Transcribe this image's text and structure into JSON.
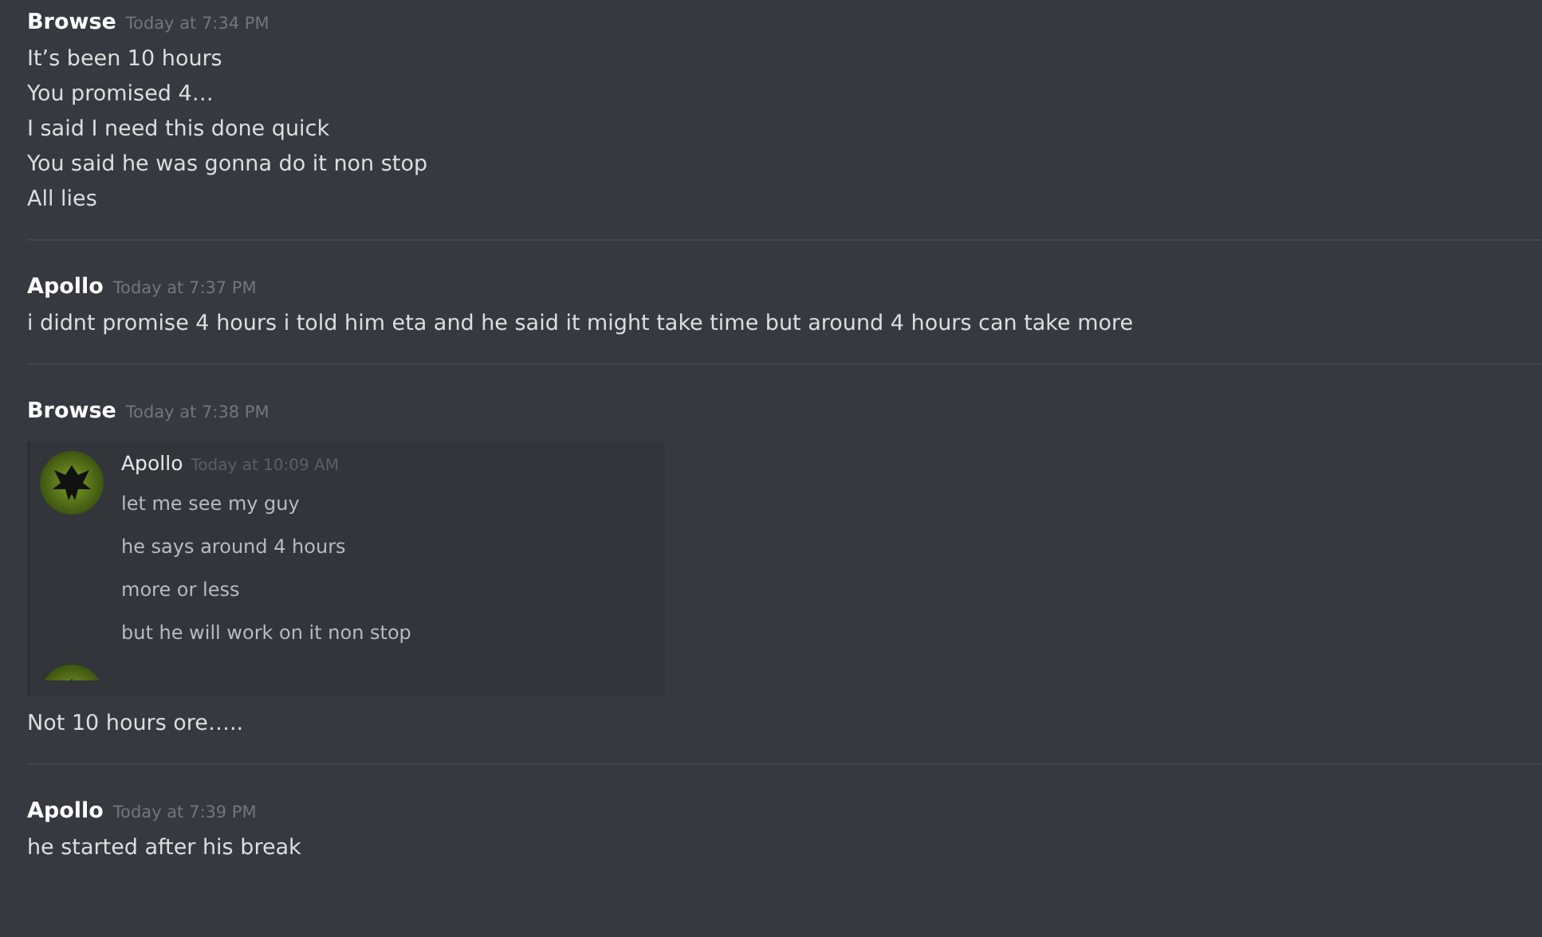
{
  "messages": [
    {
      "author": "Browse",
      "time": "Today at 7:34 PM",
      "lines": [
        "It’s been 10 hours",
        "You promised 4…",
        "I said I need this done quick",
        "You said he was gonna do it non stop",
        "All lies"
      ]
    },
    {
      "author": "Apollo",
      "time": "Today at 7:37 PM",
      "lines": [
        "i didnt promise 4 hours i told him eta and he said it might take time but around 4 hours can take more"
      ]
    },
    {
      "author": "Browse",
      "time": "Today at 7:38 PM",
      "screenshot": {
        "author": "Apollo",
        "time": "Today at 10:09 AM",
        "lines": [
          "let me see my guy",
          "he says around 4 hours",
          "more or less",
          "but he will work on it non stop"
        ]
      },
      "after_lines": [
        "Not 10 hours ore….."
      ]
    },
    {
      "author": "Apollo",
      "time": "Today at 7:39 PM",
      "lines": [
        "he started after his break"
      ]
    }
  ]
}
